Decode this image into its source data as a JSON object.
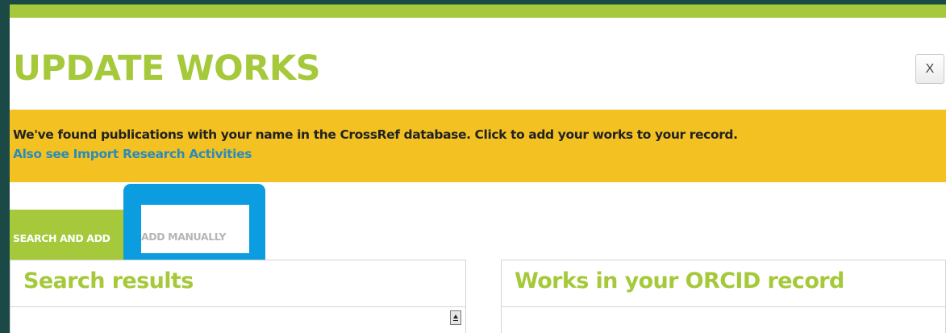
{
  "modal": {
    "title": "UPDATE WORKS",
    "close_label": "X"
  },
  "banner": {
    "message": "We've found publications with your name in the CrossRef database. Click to add your works to your record.",
    "link": "Also see Import Research Activities"
  },
  "tabs": {
    "search_and_add": "SEARCH AND ADD",
    "add_manually": "ADD MANUALLY"
  },
  "panels": {
    "search_results_title": "Search results",
    "orcid_works_title": "Works in your ORCID record"
  },
  "colors": {
    "accent_green": "#a5c93a",
    "banner_yellow": "#f3c222",
    "link_blue": "#2d8bb8",
    "highlight_blue": "#0b9de0",
    "frame_dark": "#1b4a46"
  }
}
